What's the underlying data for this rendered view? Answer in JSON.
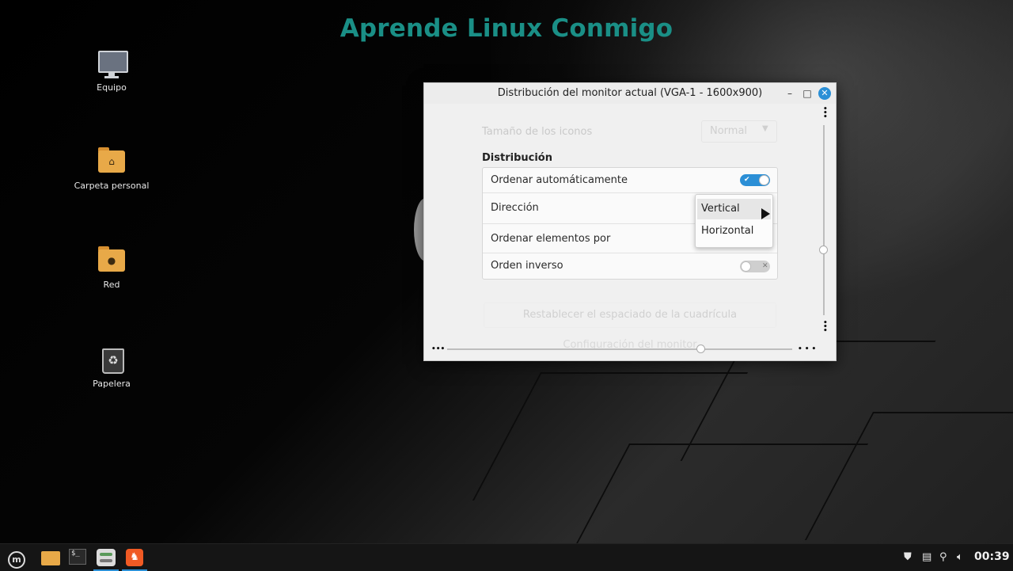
{
  "brand": {
    "title": "Aprende Linux Conmigo"
  },
  "desktop": {
    "icons": [
      {
        "label": "Equipo",
        "icon": "computer-icon"
      },
      {
        "label": "Carpeta personal",
        "icon": "home-folder-icon"
      },
      {
        "label": "Red",
        "icon": "network-folder-icon"
      },
      {
        "label": "Papelera",
        "icon": "trash-icon"
      }
    ]
  },
  "window": {
    "title": "Distribución del monitor actual (VGA-1 - 1600x900)",
    "icon_size": {
      "label": "Tamaño de los iconos",
      "value": "Normal"
    },
    "section_title": "Distribución",
    "rows": [
      {
        "label": "Ordenar automáticamente",
        "toggle": true
      },
      {
        "label": "Dirección"
      },
      {
        "label": "Ordenar elementos por"
      },
      {
        "label": "Orden inverso",
        "toggle": false
      }
    ],
    "reset_button": "Restablecer el espaciado de la cuadrícula",
    "monitor_link": "Configuración del monitor"
  },
  "direction_popup": {
    "options": [
      "Vertical",
      "Horizontal"
    ],
    "highlighted": "Vertical"
  },
  "taskbar": {
    "apps": [
      "mint-menu-icon",
      "files-icon",
      "terminal-icon",
      "settings-icon",
      "brave-icon"
    ],
    "clock": "00:39"
  },
  "colors": {
    "accent": "#2b8fd6",
    "brand": "#1a8f86",
    "folder": "#e8a948"
  }
}
